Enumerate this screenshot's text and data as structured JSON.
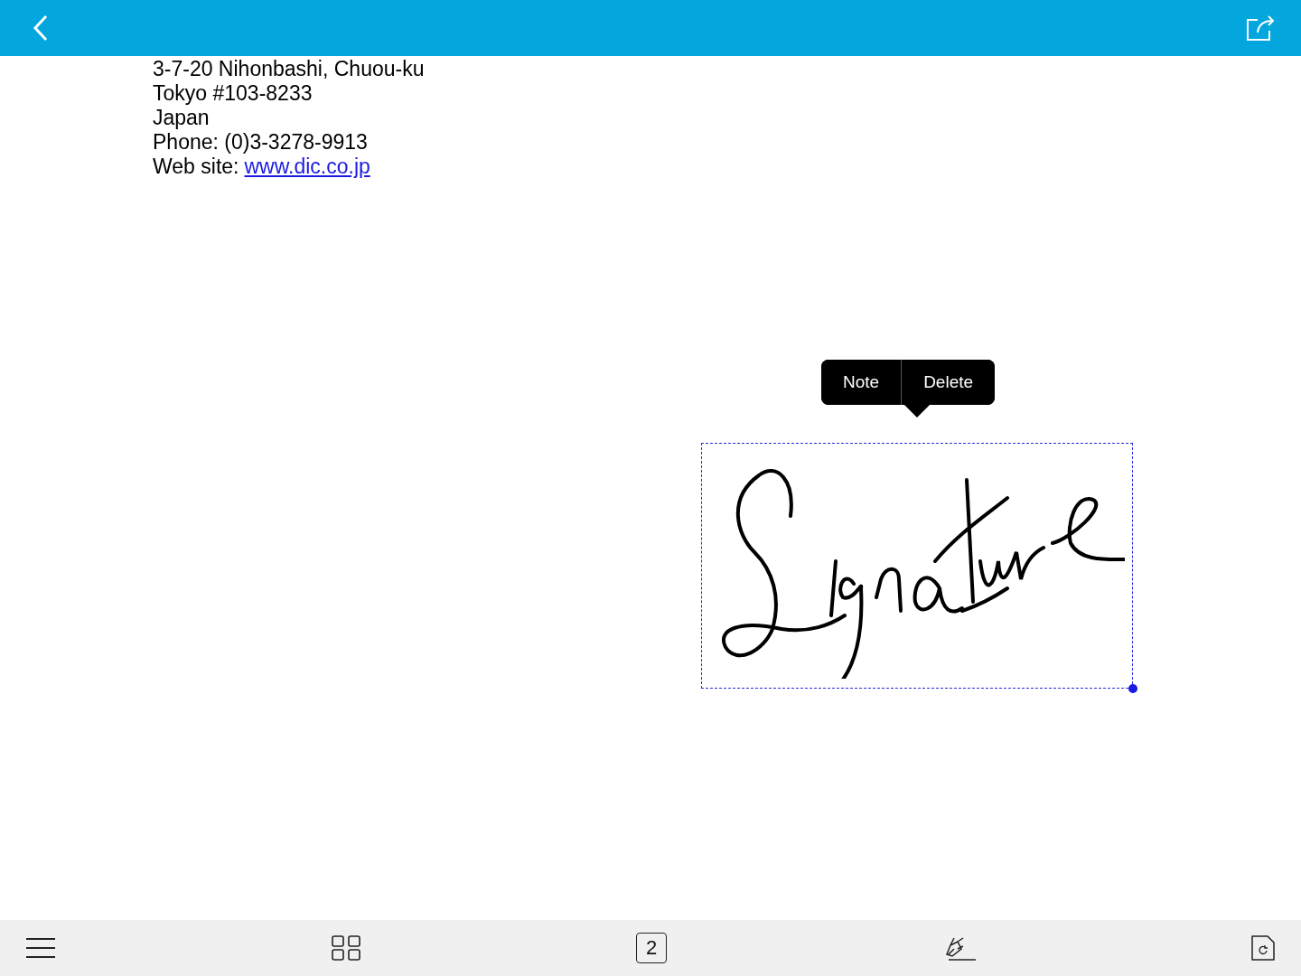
{
  "document": {
    "address_lines": [
      "3-7-20 Nihonbashi, Chuou-ku",
      "Tokyo #103-8233",
      "Japan",
      "Phone: (0)3-3278-9913"
    ],
    "website": {
      "label": "Web site:",
      "link": "www.dic.co.jp"
    }
  },
  "annotation": {
    "selected": true,
    "menu": [
      "Note",
      "Delete"
    ]
  },
  "toolbar": {
    "page": "2"
  }
}
